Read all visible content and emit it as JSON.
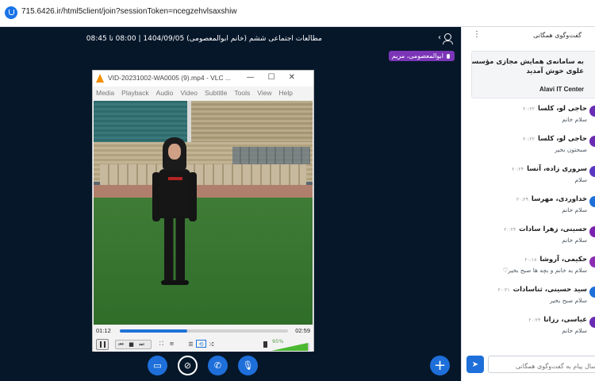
{
  "browser": {
    "url": "715.6426.ir/html5client/join?sessionToken=ncegzehvlsaxshiw",
    "security_icon": "shield-icon"
  },
  "meeting": {
    "title": "مطالعات اجتماعی ششم (خانم ابوالمعصومی) 1404/09/05 | 08:00 تا 08:45",
    "users_icon": "users-icon",
    "talking_badge": "ابوالمعصومی، مریم"
  },
  "vlc": {
    "title": "VID-20231002-WA0005 (9).mp4 - VLC ...",
    "window_buttons": [
      "—",
      "☐",
      "✕"
    ],
    "menu": [
      "Media",
      "Playback",
      "Audio",
      "Video",
      "Subtitle",
      "Tools",
      "View",
      "Help"
    ],
    "time_elapsed": "01:12",
    "time_total": "02:59",
    "progress_fraction": 0.4,
    "volume": "95%",
    "volume_fraction": 0.95,
    "accent": "#f29000"
  },
  "toolbar": {
    "buttons": [
      {
        "name": "screen-share-icon",
        "glyph": "▭"
      },
      {
        "name": "video-off-icon",
        "glyph": "⊘"
      },
      {
        "name": "phone-icon",
        "glyph": "✆"
      },
      {
        "name": "microphone-icon",
        "glyph": "🎙"
      }
    ],
    "add_glyph": "+"
  },
  "chat": {
    "title": "گفت‌وگوی همگانی",
    "menu_icon": "more-vertical-icon",
    "welcome_line1": "به سامانه‌ی همایش مجازی مؤسسه‌ی",
    "welcome_line2": "علوی خوش آمدید",
    "welcome_line3": "Alavi IT Center",
    "messages": [
      {
        "name": "حاجی لو، کلسا",
        "time": "۲۰:۲۲",
        "text": "سلام خانم",
        "color": "#6a2bb3"
      },
      {
        "name": "حاجی لو، کلسا",
        "time": "۲۰:۲۲",
        "text": "صبحتون بخیر",
        "color": "#6a2bb3"
      },
      {
        "name": "سروری زاده، آنسا",
        "time": "۲۰:۲۴",
        "text": "سلام",
        "color": "#5b38c2"
      },
      {
        "name": "خداوردی، مهرسا",
        "time": "۲۰:۲۹",
        "text": "سلام خانم",
        "color": "#1e6fd9"
      },
      {
        "name": "حسینی، زهرا سادات",
        "time": "۲۰:۲۴",
        "text": "سلام خانم",
        "color": "#7a22b0"
      },
      {
        "name": "حکیمی، آروشا",
        "time": "۲۰:۱۸",
        "text": "سلام به خانم و بچه ها صبح بخیر♡",
        "color": "#8b2db3"
      },
      {
        "name": "سید حسینی، ثناسادات",
        "time": "۲۰:۲۱",
        "text": "سلام صبح بخیر",
        "color": "#1e6fd9"
      },
      {
        "name": "عباسی، رزانا",
        "time": "۲۰:۲۴",
        "text": "سلام خانم",
        "color": "#6a2bb3"
      }
    ],
    "input_placeholder": "ارسال پیام به گفت‌وگوی همگانی",
    "send_glyph": "➤"
  }
}
